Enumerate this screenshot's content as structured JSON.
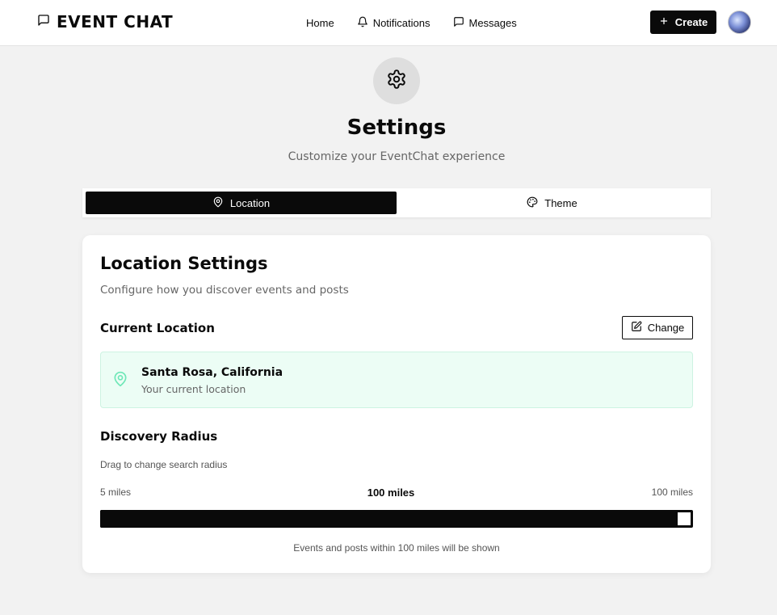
{
  "header": {
    "brand": "EVENT CHAT",
    "nav": [
      {
        "label": "Home",
        "icon": "none"
      },
      {
        "label": "Notifications",
        "icon": "bell-icon"
      },
      {
        "label": "Messages",
        "icon": "chat-bubble-icon"
      }
    ],
    "create_label": "Create"
  },
  "page": {
    "title": "Settings",
    "subtitle": "Customize your EventChat experience"
  },
  "tabs": [
    {
      "label": "Location",
      "icon": "map-pin-icon",
      "active": true
    },
    {
      "label": "Theme",
      "icon": "palette-icon",
      "active": false
    }
  ],
  "location_card": {
    "title": "Location Settings",
    "description": "Configure how you discover events and posts",
    "current_location_label": "Current Location",
    "change_label": "Change",
    "location_name": "Santa Rosa, California",
    "location_sub": "Your current location",
    "radius_label": "Discovery Radius",
    "drag_hint": "Drag to change search radius",
    "min_label": "5 miles",
    "current_label": "100 miles",
    "max_label": "100 miles",
    "radius_value": 100,
    "radius_min": 5,
    "radius_max": 100,
    "note": "Events and posts within 100 miles will be shown"
  },
  "colors": {
    "accent": "#0a0a0a",
    "location_bg": "#ecfdf5",
    "location_pin": "#6ee7b7"
  }
}
